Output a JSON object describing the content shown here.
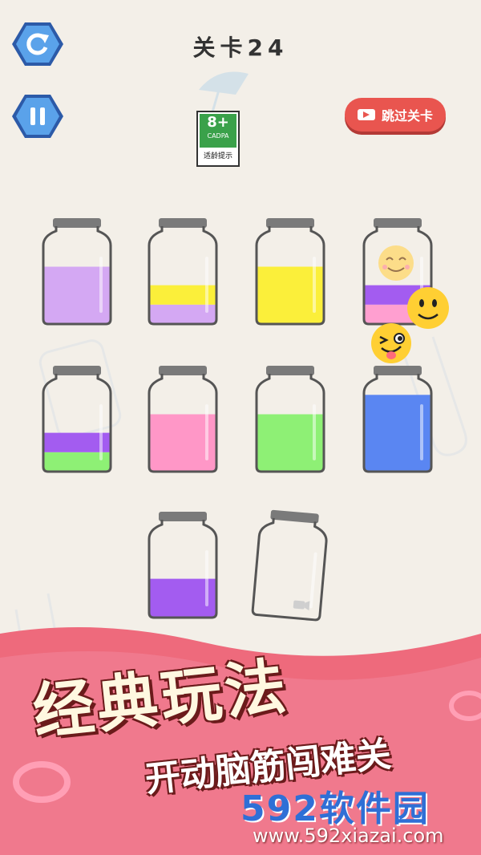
{
  "header": {
    "level_title": "关卡24",
    "skip_label": "跳过关卡",
    "restart_icon": "restart-icon",
    "pause_icon": "pause-icon"
  },
  "age_badge": {
    "rating": "8+",
    "org": "CADPA",
    "tip": "适龄提示"
  },
  "colors": {
    "background": "#f3efe8",
    "purple_light": "#d4a8f3",
    "yellow": "#fbef3a",
    "violet": "#a35cf0",
    "pink": "#ff97c7",
    "pink_light": "#ff9fd0",
    "green": "#8ef075",
    "blue": "#5a86f2",
    "skip_button": "#e9554f",
    "banner_pink": "#ee6a7c"
  },
  "bottles": [
    {
      "id": 1,
      "layers": [
        {
          "color": "#d4a8f3",
          "level": 0.65
        }
      ]
    },
    {
      "id": 2,
      "layers": [
        {
          "color": "#d4a8f3",
          "level": 0.22
        },
        {
          "color": "#fbef3a",
          "level": 0.22
        }
      ]
    },
    {
      "id": 3,
      "layers": [
        {
          "color": "#fbef3a",
          "level": 0.65
        }
      ]
    },
    {
      "id": 4,
      "layers": [
        {
          "color": "#ff9fd0",
          "level": 0.22
        },
        {
          "color": "#a35cf0",
          "level": 0.22
        }
      ]
    },
    {
      "id": 5,
      "layers": [
        {
          "color": "#8ef075",
          "level": 0.22
        },
        {
          "color": "#a35cf0",
          "level": 0.22
        }
      ]
    },
    {
      "id": 6,
      "layers": [
        {
          "color": "#ff97c7",
          "level": 0.65
        }
      ]
    },
    {
      "id": 7,
      "layers": [
        {
          "color": "#8ef075",
          "level": 0.65
        }
      ]
    },
    {
      "id": 8,
      "layers": [
        {
          "color": "#5a86f2",
          "level": 0.87
        }
      ]
    },
    {
      "id": 9,
      "layers": [
        {
          "color": "#a35cf0",
          "level": 0.44
        }
      ]
    },
    {
      "id": 10,
      "layers": [],
      "locked_by_video": true
    }
  ],
  "banner": {
    "title": "经典玩法",
    "subtitle": "开动脑筋闯难关"
  },
  "watermark": {
    "logo": "592软件园",
    "url": "www.592xiazai.com"
  }
}
